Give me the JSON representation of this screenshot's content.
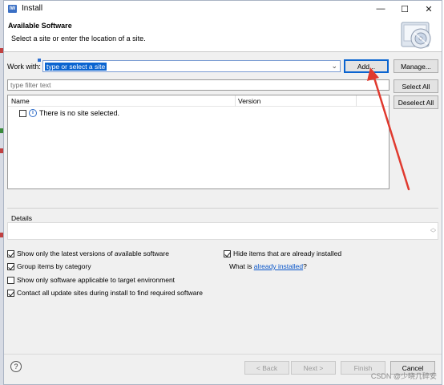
{
  "window": {
    "icon_text": "IW",
    "title": "Install",
    "minimize": "—",
    "maximize": "☐",
    "close": "✕"
  },
  "banner": {
    "title": "Available Software",
    "subtitle": "Select a site or enter the location of a site."
  },
  "work_with": {
    "label": "Work with:",
    "value": "type or select a site",
    "add_label": "Add...",
    "manage_label": "Manage..."
  },
  "filter": {
    "placeholder": "type filter text",
    "select_all": "Select All",
    "deselect_all": "Deselect All"
  },
  "tree": {
    "columns": [
      "Name",
      "Version"
    ],
    "rows": [
      {
        "checked": false,
        "icon": "info-icon",
        "text": "There is no site selected."
      }
    ]
  },
  "details": {
    "label": "Details"
  },
  "options": {
    "show_latest": {
      "label": "Show only the latest versions of available software",
      "checked": true
    },
    "hide_installed": {
      "label": "Hide items that are already installed",
      "checked": true
    },
    "group_by_category": {
      "label": "Group items by category",
      "checked": true
    },
    "what_is_prefix": "What is ",
    "what_is_link": "already installed",
    "what_is_suffix": "?",
    "target_env": {
      "label": "Show only software applicable to target environment",
      "checked": false
    },
    "contact_sites": {
      "label": "Contact all update sites during install to find required software",
      "checked": true
    }
  },
  "footer": {
    "help": "?",
    "back": "< Back",
    "next": "Next >",
    "finish": "Finish",
    "cancel": "Cancel"
  },
  "watermark": "CSDN @少晓几碎安",
  "colors": {
    "selection": "#0a64d0",
    "link": "#0a56c9",
    "annotation_arrow": "#e03a2f"
  }
}
